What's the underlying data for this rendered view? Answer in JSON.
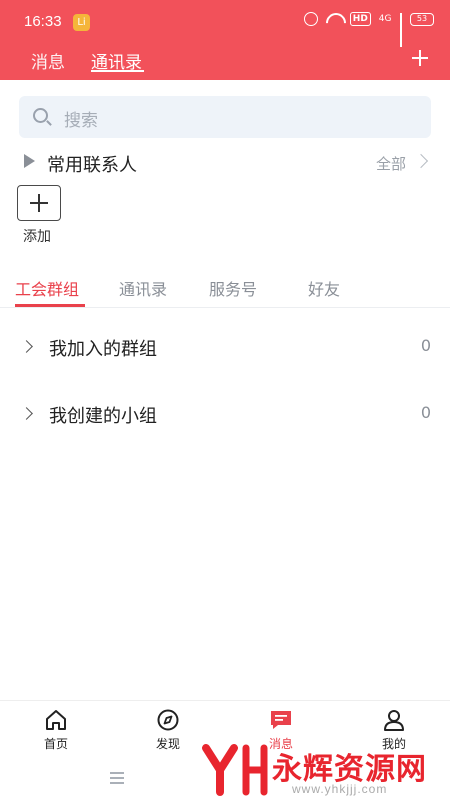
{
  "status_bar": {
    "time": "16:33",
    "app_badge": "Li",
    "network": "4G",
    "hd": "HD",
    "battery": "53"
  },
  "header": {
    "tabs": [
      {
        "label": "消息",
        "active": false
      },
      {
        "label": "通讯录",
        "active": true
      }
    ]
  },
  "search": {
    "placeholder": "搜索"
  },
  "frequent_contacts": {
    "title": "常用联系人",
    "all_label": "全部"
  },
  "add": {
    "label": "添加"
  },
  "sub_tabs": [
    {
      "label": "工会群组",
      "active": true
    },
    {
      "label": "通讯录",
      "active": false
    },
    {
      "label": "服务号",
      "active": false
    },
    {
      "label": "好友",
      "active": false
    }
  ],
  "groups": [
    {
      "label": "我加入的群组",
      "count": "0"
    },
    {
      "label": "我创建的小组",
      "count": "0"
    }
  ],
  "bottom_nav": [
    {
      "label": "首页",
      "icon": "home-icon",
      "active": false
    },
    {
      "label": "发现",
      "icon": "compass-icon",
      "active": false
    },
    {
      "label": "消息",
      "icon": "message-icon",
      "active": true
    },
    {
      "label": "我的",
      "icon": "user-icon",
      "active": false
    }
  ],
  "watermark": {
    "text": "永辉资源网",
    "url": "www.yhkjjj.com"
  },
  "colors": {
    "brand_red": "#f2515a",
    "active_red": "#e9414b",
    "search_bg": "#eef3f9"
  }
}
